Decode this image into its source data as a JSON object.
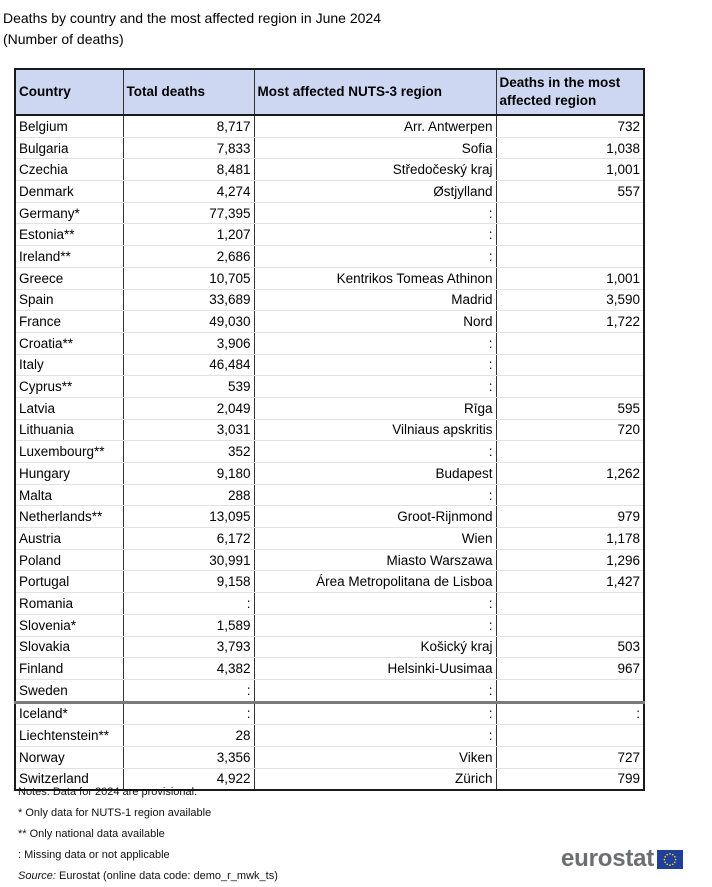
{
  "title": {
    "line1": "Deaths by country and the most affected region in June 2024",
    "line2": "(Number of deaths)"
  },
  "table": {
    "headers": [
      "Country",
      "Total deaths",
      "Most affected NUTS-3 region",
      "Deaths in the most affected region"
    ],
    "rows": [
      {
        "country": "Belgium",
        "total": "8,717",
        "region": "Arr. Antwerpen",
        "region_deaths": "732"
      },
      {
        "country": "Bulgaria",
        "total": "7,833",
        "region": "Sofia",
        "region_deaths": "1,038"
      },
      {
        "country": "Czechia",
        "total": "8,481",
        "region": "Středočeský kraj",
        "region_deaths": "1,001"
      },
      {
        "country": "Denmark",
        "total": "4,274",
        "region": "Østjylland",
        "region_deaths": "557"
      },
      {
        "country": "Germany*",
        "total": "77,395",
        "region": ":",
        "region_deaths": ""
      },
      {
        "country": "Estonia**",
        "total": "1,207",
        "region": ":",
        "region_deaths": ""
      },
      {
        "country": "Ireland**",
        "total": "2,686",
        "region": ":",
        "region_deaths": ""
      },
      {
        "country": "Greece",
        "total": "10,705",
        "region": "Kentrikos Tomeas Athinon",
        "region_deaths": "1,001"
      },
      {
        "country": "Spain",
        "total": "33,689",
        "region": "Madrid",
        "region_deaths": "3,590"
      },
      {
        "country": "France",
        "total": "49,030",
        "region": "Nord",
        "region_deaths": "1,722"
      },
      {
        "country": "Croatia**",
        "total": "3,906",
        "region": ":",
        "region_deaths": ""
      },
      {
        "country": "Italy",
        "total": "46,484",
        "region": ":",
        "region_deaths": ""
      },
      {
        "country": "Cyprus**",
        "total": "539",
        "region": ":",
        "region_deaths": ""
      },
      {
        "country": "Latvia",
        "total": "2,049",
        "region": "Rīga",
        "region_deaths": "595"
      },
      {
        "country": "Lithuania",
        "total": "3,031",
        "region": "Vilniaus apskritis",
        "region_deaths": "720"
      },
      {
        "country": "Luxembourg**",
        "total": "352",
        "region": ":",
        "region_deaths": ""
      },
      {
        "country": "Hungary",
        "total": "9,180",
        "region": "Budapest",
        "region_deaths": "1,262"
      },
      {
        "country": "Malta",
        "total": "288",
        "region": ":",
        "region_deaths": ""
      },
      {
        "country": "Netherlands**",
        "total": "13,095",
        "region": "Groot-Rijnmond",
        "region_deaths": "979"
      },
      {
        "country": "Austria",
        "total": "6,172",
        "region": "Wien",
        "region_deaths": "1,178"
      },
      {
        "country": "Poland",
        "total": "30,991",
        "region": "Miasto Warszawa",
        "region_deaths": "1,296"
      },
      {
        "country": "Portugal",
        "total": "9,158",
        "region": "Área Metropolitana de Lisboa",
        "region_deaths": "1,427"
      },
      {
        "country": "Romania",
        "total": ":",
        "region": ":",
        "region_deaths": ""
      },
      {
        "country": "Slovenia*",
        "total": "1,589",
        "region": ":",
        "region_deaths": ""
      },
      {
        "country": "Slovakia",
        "total": "3,793",
        "region": "Košický kraj",
        "region_deaths": "503"
      },
      {
        "country": "Finland",
        "total": "4,382",
        "region": "Helsinki-Uusimaa",
        "region_deaths": "967"
      },
      {
        "country": "Sweden",
        "total": ":",
        "region": ":",
        "region_deaths": ""
      },
      {
        "country": "Iceland*",
        "total": ":",
        "region": ":",
        "region_deaths": ":",
        "group_start": true
      },
      {
        "country": "Liechtenstein**",
        "total": "28",
        "region": ":",
        "region_deaths": ""
      },
      {
        "country": "Norway",
        "total": "3,356",
        "region": "Viken",
        "region_deaths": "727"
      },
      {
        "country": "Switzerland",
        "total": "4,922",
        "region": "Zürich",
        "region_deaths": "799"
      }
    ]
  },
  "notes": {
    "provisional": "Notes: Data for 2024 are provisional.",
    "single_star": "*  Only data for NUTS-1 region available",
    "double_star": "**  Only national data available",
    "missing": ": Missing data or not applicable",
    "source_label": "Source:",
    "source_text": " Eurostat (online data code: demo_r_mwk_ts)"
  },
  "logo": {
    "text": "eurostat",
    "icon": "eu-flag-icon",
    "flag_color": "#1f3f9a",
    "star_color": "#ffdd00"
  },
  "colors": {
    "header_bg": "#cdd7f2",
    "logo_text": "#6d6e71"
  }
}
